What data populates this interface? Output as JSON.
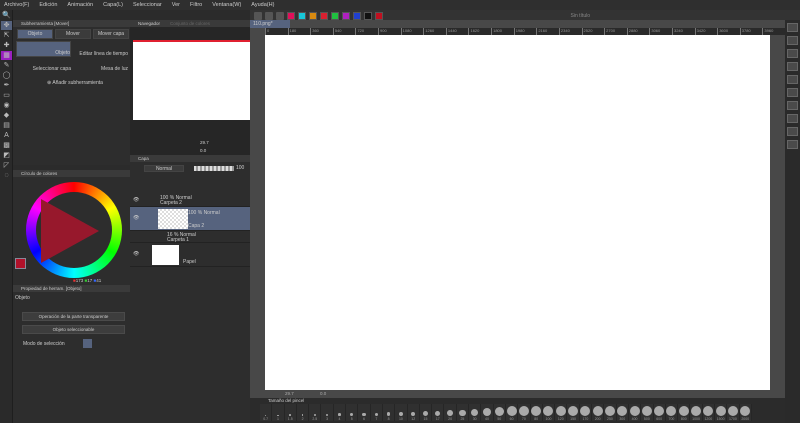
{
  "menu": [
    "Archivo(F)",
    "Edición",
    "Animación",
    "Capa(L)",
    "Seleccionar",
    "Ver",
    "Filtro",
    "Ventana(W)",
    "Ayuda(H)"
  ],
  "toolbar": {
    "swatches": [
      "#e0105a",
      "#18c8d8",
      "#d88a10",
      "#d82030",
      "#20c040",
      "#b020c0",
      "#2040d0",
      "#111111",
      "#c01020"
    ],
    "window_title": "Sin título"
  },
  "subtool": {
    "tab": "Subherramienta [Mover]",
    "groups": [
      "Objeto",
      "Mover",
      "Mover capa"
    ],
    "items": [
      "Objeto",
      "Editar línea de tiempo",
      "Seleccionar capa",
      "Mesa de luz"
    ],
    "add": "Añadir subherramienta"
  },
  "navigator": {
    "tabs": [
      "Navegador",
      "Conjunto de colores"
    ],
    "zoom": "29.7",
    "angle": "0.0"
  },
  "layers": {
    "tab": "Capa",
    "blend": "Normal",
    "opacity": "100",
    "rows": [
      {
        "mode": "100 % Normal",
        "name": "Carpeta 2"
      },
      {
        "mode": "100 % Normal",
        "name": "Capa 2"
      },
      {
        "mode": "16 % Normal",
        "name": "Carpeta 1"
      },
      {
        "mode": "",
        "name": "Papel"
      }
    ]
  },
  "color": {
    "tab": "Círculo de colores",
    "r": "173",
    "g": "17",
    "b": "41",
    "main": "#b0112a"
  },
  "property": {
    "tab": "Propiedad de herram. [Objeto]",
    "title": "Objeto",
    "op1": "Operación de la parte transparente",
    "op2": "Objeto seleccionable",
    "mode_label": "Modo de selección"
  },
  "canvas": {
    "tab": "110.png*",
    "ruler": [
      "0",
      "180",
      "360",
      "540",
      "720",
      "900",
      "1080",
      "1260",
      "1440",
      "1620",
      "1800",
      "1980",
      "2160",
      "2340",
      "2520",
      "2700",
      "2880",
      "3060",
      "3240",
      "3420",
      "3600",
      "3780",
      "3960"
    ],
    "zoom": "29.7",
    "angle": "0.0"
  },
  "brush": {
    "tab": "Tamaño del pincel",
    "sizes": [
      "0.7",
      "1",
      "1.5",
      "2",
      "2.5",
      "3",
      "4",
      "5",
      "6",
      "7",
      "8",
      "10",
      "12",
      "15",
      "17",
      "20",
      "25",
      "30",
      "40",
      "50",
      "60",
      "70",
      "80",
      "100",
      "120",
      "150",
      "170",
      "200",
      "250",
      "300",
      "400",
      "500",
      "600",
      "700",
      "800",
      "1000",
      "1200",
      "1500",
      "1700",
      "2000"
    ]
  }
}
